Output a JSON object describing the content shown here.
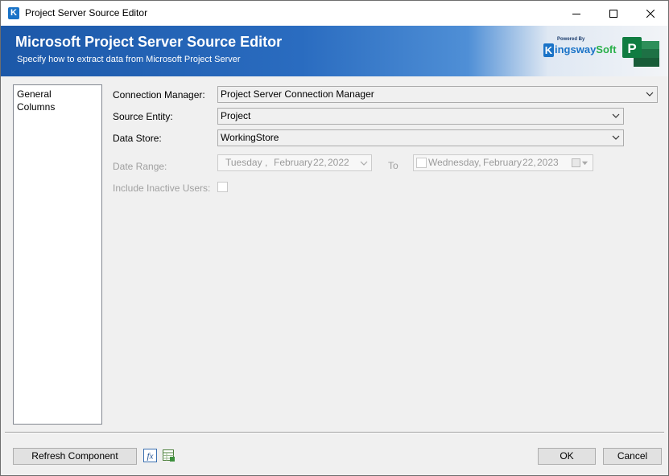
{
  "window": {
    "title": "Project Server Source Editor",
    "app_icon_letter": "K"
  },
  "banner": {
    "title": "Microsoft Project Server Source Editor",
    "subtitle": "Specify how to extract data from Microsoft Project Server",
    "logo_powered_by": "Powered By",
    "logo_k": "K",
    "logo_name_1": "ingsway",
    "logo_name_2": "Soft",
    "project_letter": "P"
  },
  "nav": {
    "items": [
      {
        "label": "General"
      },
      {
        "label": "Columns"
      }
    ]
  },
  "form": {
    "connection_manager": {
      "label": "Connection Manager:",
      "value": "Project Server Connection Manager"
    },
    "source_entity": {
      "label": "Source Entity:",
      "value": "Project"
    },
    "data_store": {
      "label": "Data Store:",
      "value": "WorkingStore"
    },
    "date_range": {
      "label": "Date Range:",
      "from": {
        "weekday": "Tuesday",
        "sep": ",",
        "month": "February",
        "day": "22,",
        "year": "2022"
      },
      "to_label": "To",
      "to": {
        "weekday": "Wednesday,",
        "month": "February",
        "day": "22,",
        "year": "2023"
      }
    },
    "include_inactive": {
      "label": "Include Inactive Users:"
    }
  },
  "footer": {
    "refresh_label": "Refresh Component",
    "fx_icon": "fx",
    "ok_label": "OK",
    "cancel_label": "Cancel"
  },
  "colors": {
    "banner_start": "#1c58a8",
    "kingsway_blue": "#1a73c7",
    "kingsway_green": "#2ab04a",
    "project_green": "#1e7145"
  }
}
